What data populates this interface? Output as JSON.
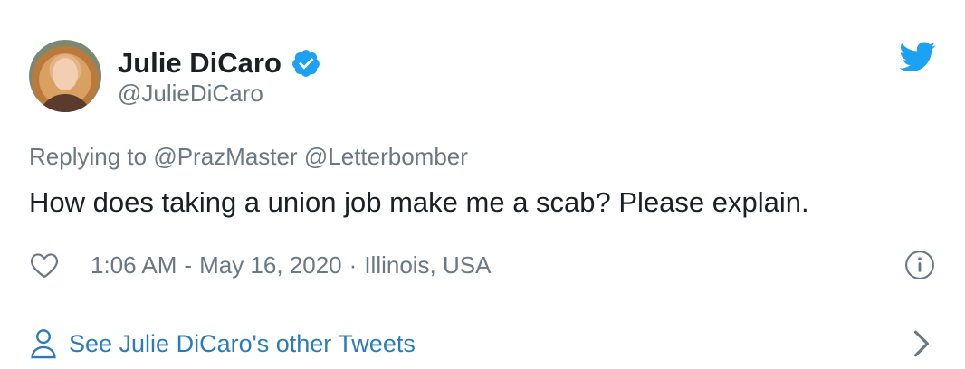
{
  "author": {
    "display_name": "Julie DiCaro",
    "handle": "@JulieDiCaro"
  },
  "reply": {
    "prefix": "Replying to",
    "mentions": [
      "@PrazMaster",
      "@Letterbomber"
    ]
  },
  "tweet": {
    "text": "How does taking a union job make me a scab? Please explain."
  },
  "meta": {
    "time": "1:06 AM",
    "dash": "-",
    "date": "May 16, 2020",
    "dot": "·",
    "location": "Illinois, USA"
  },
  "footer": {
    "link_label": "See Julie DiCaro's other Tweets"
  },
  "icons": {
    "verified": "verified-badge-icon",
    "bird": "twitter-bird-icon",
    "heart": "heart-icon",
    "info": "info-icon",
    "person": "person-icon",
    "chevron": "chevron-right-icon"
  },
  "colors": {
    "verified_blue": "#1da1f2",
    "twitter_blue": "#1da1f2",
    "link_blue": "#2b7bb9",
    "muted": "#697882",
    "text": "#1c2022",
    "divider": "#e1e8ed"
  }
}
